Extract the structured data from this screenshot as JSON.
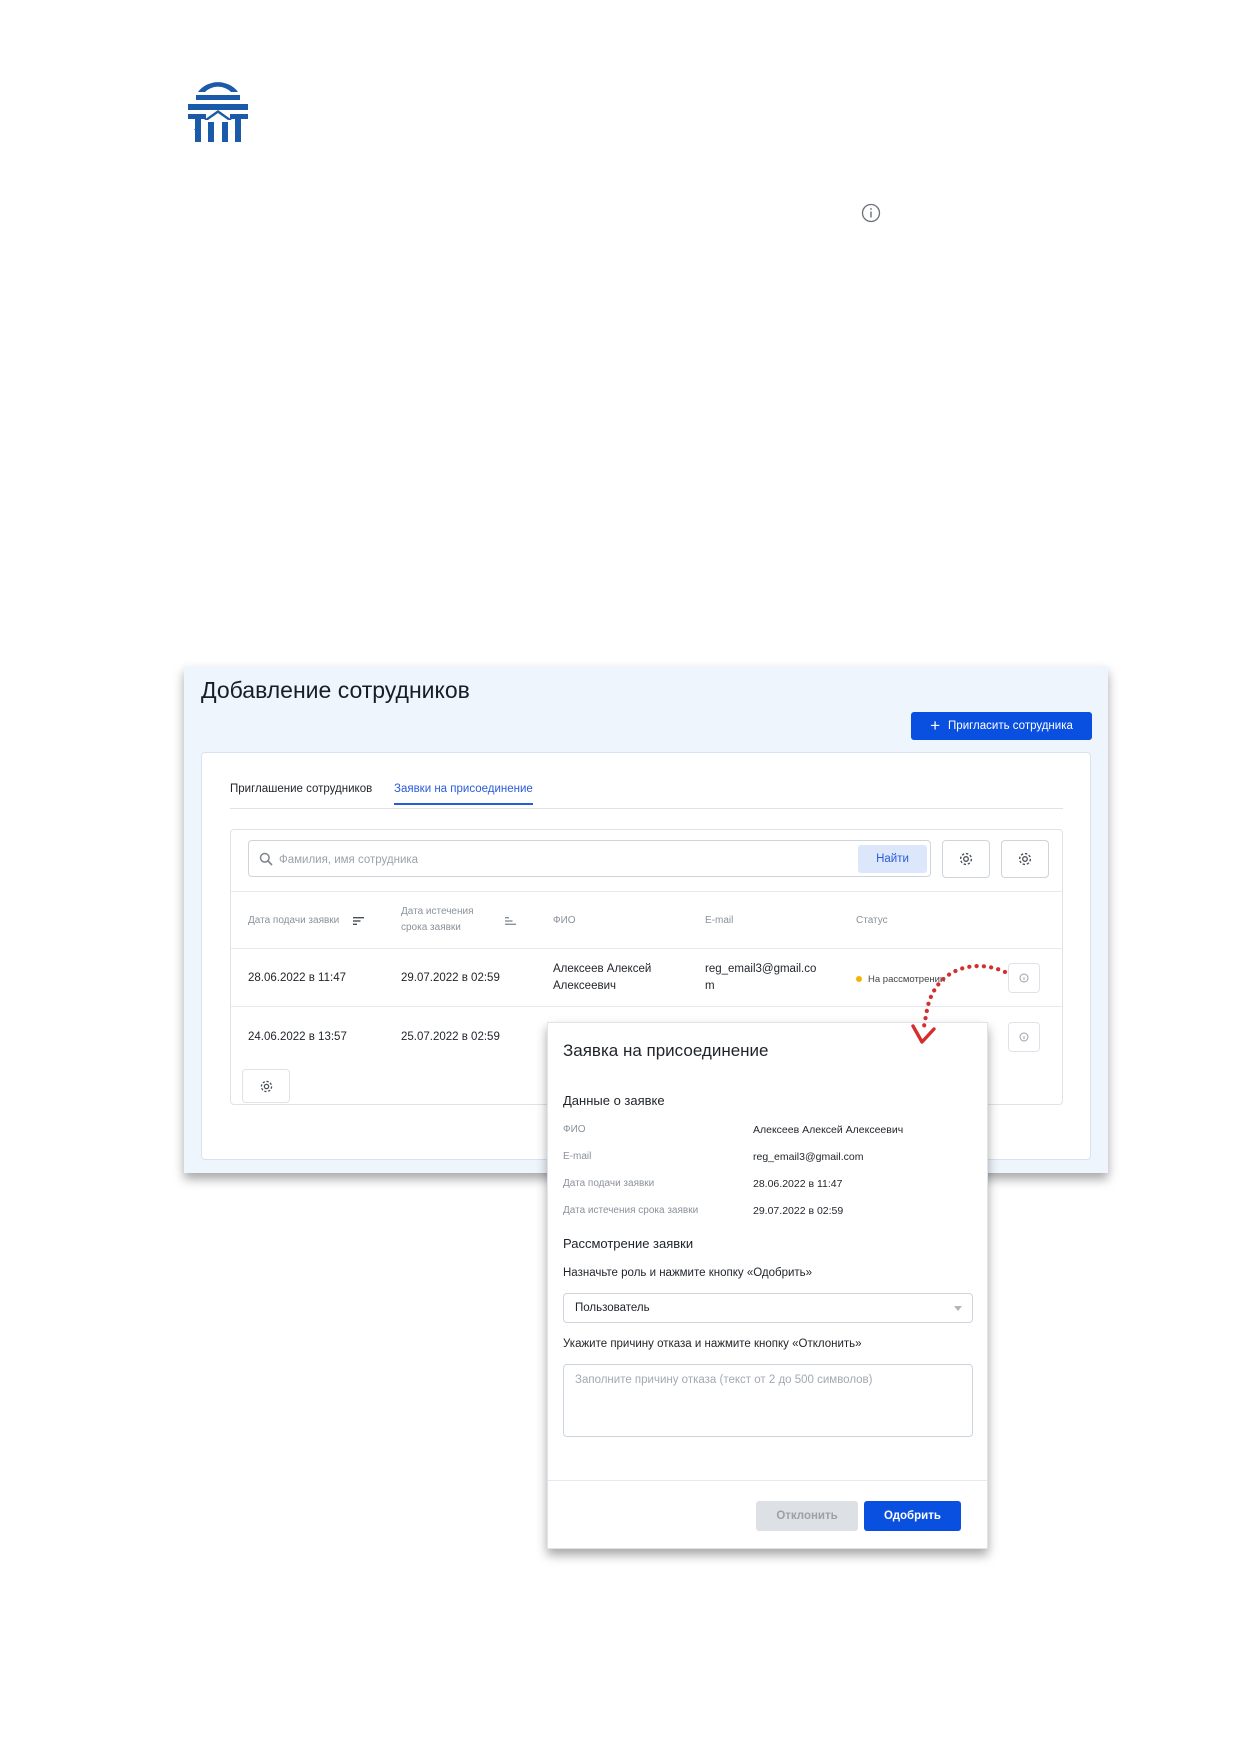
{
  "colors": {
    "logo_blue": "#1a5aa8",
    "primary": "#0a50e0",
    "status_pending": "#f5b400",
    "arrow_red": "#d32f2f"
  },
  "screen": {
    "title": "Добавление сотрудников",
    "invite_button": "Пригласить сотрудника",
    "tabs": [
      "Приглашение сотрудников",
      "Заявки на присоединение"
    ],
    "active_tab": "Заявки на присоединение",
    "search": {
      "placeholder": "Фамилия, имя сотрудника",
      "button": "Найти"
    },
    "table": {
      "columns": {
        "submitted": "Дата подачи заявки",
        "expires_line1": "Дата истечения",
        "expires_line2": "срока заявки",
        "name": "ФИО",
        "email": "E-mail",
        "status": "Статус"
      },
      "rows": [
        {
          "submitted": "28.06.2022 в 11:47",
          "expires": "29.07.2022 в 02:59",
          "name_line1": "Алексеев Алексей",
          "name_line2": "Алексеевич",
          "email_line1": "reg_email3@gmail.co",
          "email_line2": "m",
          "status": "На рассмотрении"
        },
        {
          "submitted": "24.06.2022 в 13:57",
          "expires": "25.07.2022 в 02:59"
        }
      ]
    }
  },
  "modal": {
    "title": "Заявка на присоединение",
    "section_data": "Данные о заявке",
    "fields": [
      {
        "label": "ФИО",
        "value": "Алексеев Алексей Алексеевич"
      },
      {
        "label": "E-mail",
        "value": "reg_email3@gmail.com"
      },
      {
        "label": "Дата подачи заявки",
        "value": "28.06.2022 в 11:47"
      },
      {
        "label": "Дата истечения срока заявки",
        "value": "29.07.2022 в 02:59"
      }
    ],
    "section_review": "Рассмотрение заявки",
    "role_hint": "Назначьте роль и нажмите кнопку «Одобрить»",
    "role_value": "Пользователь",
    "reject_hint": "Укажите причину отказа и нажмите кнопку «Отклонить»",
    "reject_placeholder": "Заполните причину отказа (текст от 2 до 500 символов)",
    "reject_button": "Отклонить",
    "approve_button": "Одобрить"
  }
}
